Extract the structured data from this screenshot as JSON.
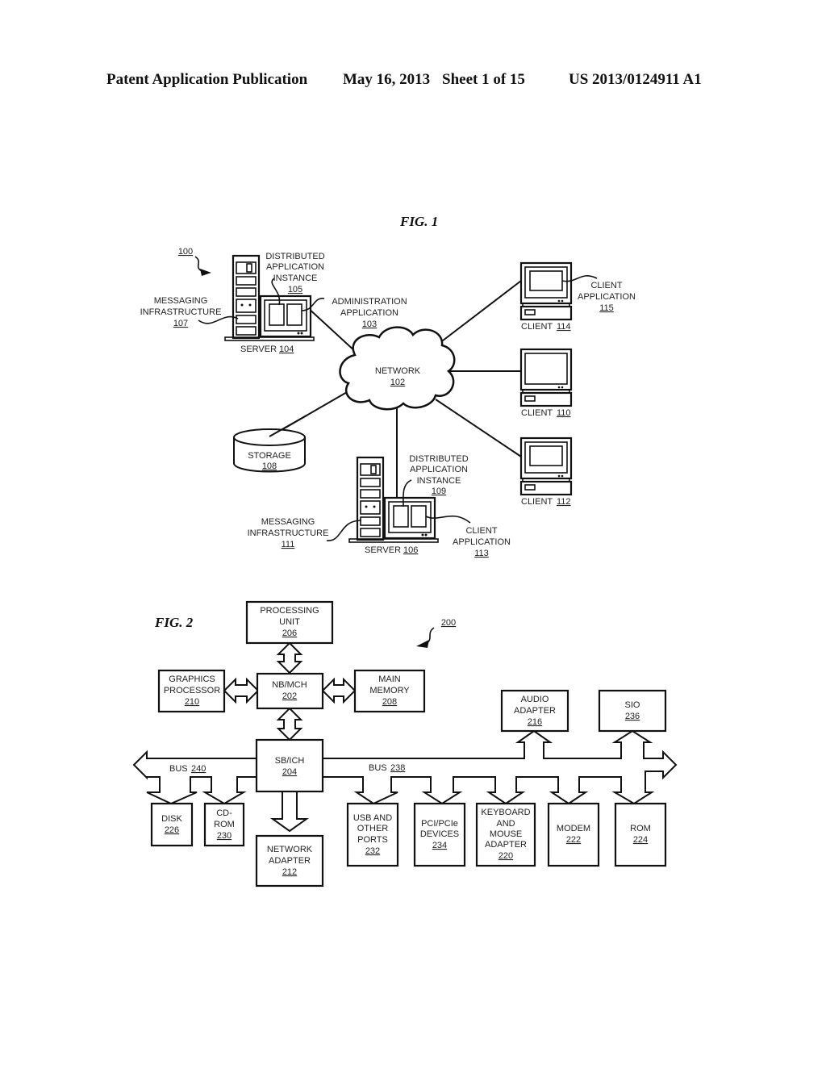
{
  "header": {
    "publication": "Patent Application Publication",
    "date": "May 16, 2013",
    "sheet": "Sheet 1 of 15",
    "number": "US 2013/0124911 A1"
  },
  "fig1": {
    "title": "FIG. 1",
    "ref": "100",
    "server104": {
      "label": "SERVER",
      "num": "104"
    },
    "dai105": {
      "l1": "DISTRIBUTED",
      "l2": "APPLICATION",
      "l3": "INSTANCE",
      "num": "105"
    },
    "msg107": {
      "l1": "MESSAGING",
      "l2": "INFRASTRUCTURE",
      "num": "107"
    },
    "admin103": {
      "l1": "ADMINISTRATION",
      "l2": "APPLICATION",
      "num": "103"
    },
    "network": {
      "label": "NETWORK",
      "num": "102"
    },
    "storage": {
      "label": "STORAGE",
      "num": "108"
    },
    "client114": {
      "label": "CLIENT",
      "num": "114"
    },
    "clientapp115": {
      "l1": "CLIENT",
      "l2": "APPLICATION",
      "num": "115"
    },
    "client110": {
      "label": "CLIENT",
      "num": "110"
    },
    "client112": {
      "label": "CLIENT",
      "num": "112"
    },
    "server106": {
      "label": "SERVER",
      "num": "106"
    },
    "dai109": {
      "l1": "DISTRIBUTED",
      "l2": "APPLICATION",
      "l3": "INSTANCE",
      "num": "109"
    },
    "msg111": {
      "l1": "MESSAGING",
      "l2": "INFRASTRUCTURE",
      "num": "111"
    },
    "clientapp113": {
      "l1": "CLIENT",
      "l2": "APPLICATION",
      "num": "113"
    }
  },
  "fig2": {
    "title": "FIG. 2",
    "ref": "200",
    "processing": {
      "l1": "PROCESSING",
      "l2": "UNIT",
      "num": "206"
    },
    "nbmch": {
      "l1": "NB/MCH",
      "num": "202"
    },
    "graphics": {
      "l1": "GRAPHICS",
      "l2": "PROCESSOR",
      "num": "210"
    },
    "mainmem": {
      "l1": "MAIN",
      "l2": "MEMORY",
      "num": "208"
    },
    "sbich": {
      "l1": "SB/ICH",
      "num": "204"
    },
    "bus240": {
      "label": "BUS",
      "num": "240"
    },
    "bus238": {
      "label": "BUS",
      "num": "238"
    },
    "disk": {
      "l1": "DISK",
      "num": "226"
    },
    "cdrom": {
      "l1": "CD-",
      "l2": "ROM",
      "num": "230"
    },
    "netadapter": {
      "l1": "NETWORK",
      "l2": "ADAPTER",
      "num": "212"
    },
    "usb": {
      "l1": "USB AND",
      "l2": "OTHER",
      "l3": "PORTS",
      "num": "232"
    },
    "pci": {
      "l1": "PCI/PCIe",
      "l2": "DEVICES",
      "num": "234"
    },
    "keyboard": {
      "l1": "KEYBOARD",
      "l2": "AND",
      "l3": "MOUSE",
      "l4": "ADAPTER",
      "num": "220"
    },
    "modem": {
      "l1": "MODEM",
      "num": "222"
    },
    "rom": {
      "l1": "ROM",
      "num": "224"
    },
    "audio": {
      "l1": "AUDIO",
      "l2": "ADAPTER",
      "num": "216"
    },
    "sio": {
      "l1": "SIO",
      "num": "236"
    }
  }
}
